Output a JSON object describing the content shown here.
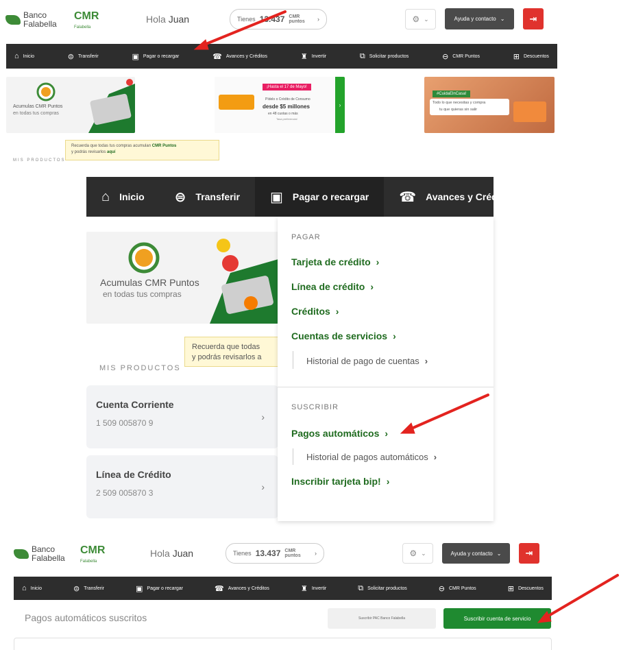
{
  "header_top": {
    "bank_line1": "Banco",
    "bank_line2": "Falabella",
    "cmr": "CMR",
    "cmr_sub": "Falabella",
    "greeting": "Hola",
    "user": "Juan",
    "points_prefix": "Tienes",
    "points_value": "13.437",
    "points_suffix_1": "CMR",
    "points_suffix_2": "puntos",
    "gear_icon": "gear-icon",
    "help_label": "Ayuda y contacto",
    "logout_icon": "logout-icon"
  },
  "nav": [
    {
      "label": "Inicio",
      "icon": "home-icon",
      "glyph": "⌂"
    },
    {
      "label": "Transferir",
      "icon": "transfer-icon",
      "glyph": "⊜"
    },
    {
      "label": "Pagar o recargar",
      "icon": "pay-icon",
      "glyph": "▣"
    },
    {
      "label": "Avances y Créditos",
      "icon": "atm-icon",
      "glyph": "☎"
    },
    {
      "label": "Invertir",
      "icon": "invest-icon",
      "glyph": "♜"
    },
    {
      "label": "Solicitar productos",
      "icon": "request-icon",
      "glyph": "⧉"
    },
    {
      "label": "CMR Puntos",
      "icon": "points-icon",
      "glyph": "⊖"
    },
    {
      "label": "Descuentos",
      "icon": "gift-icon",
      "glyph": "⊞"
    }
  ],
  "banners": {
    "cmr_puntos_title": "Acumulas CMR Puntos",
    "cmr_puntos_sub": "en todas tus compras",
    "cmr_puntos_badge": "CMR puntos",
    "promo_tag": "¡Hasta el 17 de Mayo!",
    "promo_line1": "Pídelo o Crédito de Consumo",
    "promo_line2": "desde $5 millones",
    "promo_line3": "en 48 cuotas o más",
    "promo_foot": "Tasa preferencial",
    "car_tag": "#CuidaElnCasa!",
    "car_line1": "Todo lo que necesitas y compra",
    "car_line2": "tu que quieras sin salir"
  },
  "tooltip": {
    "line1_a": "Recuerda que todas tus compras acumulan ",
    "line1_b": "CMR Puntos",
    "line2_a": "y podrás revisarlos ",
    "line2_b": "aquí",
    "zoom_line1": "Recuerda que todas",
    "zoom_line2": "y podrás revisarlos a"
  },
  "mis_productos": "MIS PRODUCTOS",
  "dropdown": {
    "pagar_heading": "PAGAR",
    "pagar_items": [
      "Tarjeta de crédito",
      "Línea de crédito",
      "Créditos",
      "Cuentas de servicios"
    ],
    "pagar_sub": "Historial de pago de cuentas",
    "suscribir_heading": "SUSCRIBIR",
    "suscribir_items": [
      "Pagos automáticos"
    ],
    "suscribir_sub": "Historial de pagos automáticos",
    "inscribir": "Inscribir tarjeta bip!"
  },
  "products": [
    {
      "name": "Cuenta Corriente",
      "number": "1 509 005870 9"
    },
    {
      "name": "Línea de Crédito",
      "number": "2 509 005870 3"
    }
  ],
  "page3": {
    "title": "Pagos automáticos suscritos",
    "secondary_button": "Suscribir PAC Banco Falabella",
    "primary_button": "Suscribir cuenta de servicio"
  },
  "colors": {
    "brand_green": "#3d8b37",
    "nav_bg": "#2d2d2d",
    "exit_red": "#e0322d",
    "arrow_red": "#e3231f"
  }
}
